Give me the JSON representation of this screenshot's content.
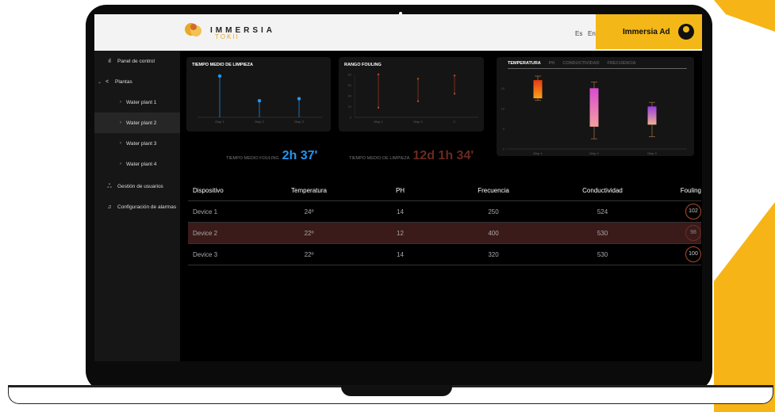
{
  "header": {
    "brand": "IMMERSIA",
    "brand_sub": "TOKII",
    "lang_es": "Es",
    "lang_en": "En",
    "user_name": "Immersia Ad"
  },
  "sidebar": {
    "items": [
      {
        "label": "Panel de control",
        "icon": "bar-chart-icon"
      },
      {
        "label": "Plantas",
        "icon": "share-icon"
      },
      {
        "label": "Water plant 1"
      },
      {
        "label": "Water plant 2"
      },
      {
        "label": "Water plant 3"
      },
      {
        "label": "Water plant 4"
      },
      {
        "label": "Gestión de usuarios",
        "icon": "users-icon"
      },
      {
        "label": "Configuración de alarmas",
        "icon": "bell-icon"
      }
    ]
  },
  "cards": {
    "limpieza": {
      "title": "TIEMPO MEDIO DE LIMPIEZA",
      "metric_label": "TIEMPO MEDIO FOULING",
      "metric_value": "2h 37'"
    },
    "fouling": {
      "title": "RANGO FOULING",
      "metric_label": "TIEMPO MEDIO DE LIMPIEZA",
      "metric_value": "12d 1h 34'"
    },
    "boxplot": {
      "tabs": [
        "TEMPERATURA",
        "PH",
        "CONDUCTIVIDAD",
        "FRECUENCIA"
      ]
    }
  },
  "chart_data": [
    {
      "type": "scatter",
      "categories": [
        "Disp 1",
        "Disp 2",
        "Disp 3"
      ],
      "values": [
        100,
        40,
        45
      ]
    },
    {
      "type": "range",
      "categories": [
        "Disp 1",
        "Disp 2",
        "C"
      ],
      "y_ticks": [
        "0",
        "20",
        "40",
        "60",
        "80"
      ],
      "ranges": [
        [
          18,
          80
        ],
        [
          30,
          72
        ],
        [
          44,
          78
        ]
      ]
    },
    {
      "type": "box",
      "categories": [
        "Disp 1",
        "Disp 2",
        "Disp 3"
      ],
      "y_ticks": [
        "0",
        "5",
        "10",
        "15"
      ],
      "boxes": [
        {
          "min": 12,
          "q1": 12.5,
          "q3": 17,
          "max": 18,
          "colors": [
            "#f6a21b",
            "#e83a12"
          ]
        },
        {
          "min": 2.5,
          "q1": 5.5,
          "q3": 15,
          "max": 16.5,
          "colors": [
            "#f3a0a0",
            "#d94bd0"
          ]
        },
        {
          "min": 3,
          "q1": 6,
          "q3": 10.5,
          "max": 11.5,
          "colors": [
            "#f0b090",
            "#9b3ee0"
          ]
        }
      ]
    }
  ],
  "table": {
    "headers": [
      "Dispositivo",
      "Temperatura",
      "PH",
      "Frecuencia",
      "Conductividad",
      "Fouling"
    ],
    "rows": [
      [
        "Device 1",
        "24º",
        "14",
        "250",
        "524",
        "102"
      ],
      [
        "Device 2",
        "22º",
        "12",
        "400",
        "530",
        "98"
      ],
      [
        "Device 3",
        "22º",
        "14",
        "320",
        "530",
        "100"
      ]
    ]
  },
  "colors": {
    "accent": "#f3b717",
    "blue": "#2196f3",
    "fouling_red": "#b14a2c",
    "highlight_row": "#3b1a1a"
  }
}
